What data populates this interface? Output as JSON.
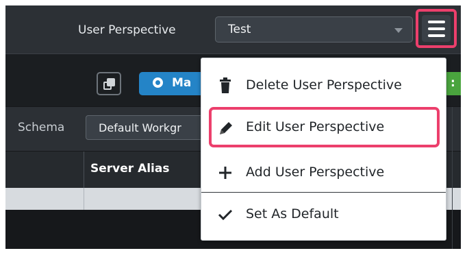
{
  "header": {
    "perspective_label": "User Perspective",
    "perspective_value": "Test",
    "menu_button_icon": "hamburger-menu-icon"
  },
  "toolbar": {
    "copy_icon": "copy-icon",
    "manage_icon": "gear-icon",
    "manage_label_visible": "Ma",
    "extra_button_label_visible": ":"
  },
  "filters": {
    "schema_label": "Schema",
    "schema_value_visible": "Default Workgr"
  },
  "table": {
    "columns": [
      "",
      "Server Alias"
    ]
  },
  "dropdown": {
    "items": [
      {
        "label": "Delete User Perspective",
        "icon": "trash-icon"
      },
      {
        "label": "Edit User Perspective",
        "icon": "pencil-icon",
        "highlighted": true
      },
      {
        "label": "Add User Perspective",
        "icon": "plus-icon"
      },
      {
        "label": "Set As Default",
        "icon": "check-icon"
      }
    ]
  },
  "colors": {
    "highlight": "#ec3f6c",
    "primary_button": "#2484c7",
    "success_button": "#4aa43e",
    "topbar_bg": "#2c3035"
  }
}
